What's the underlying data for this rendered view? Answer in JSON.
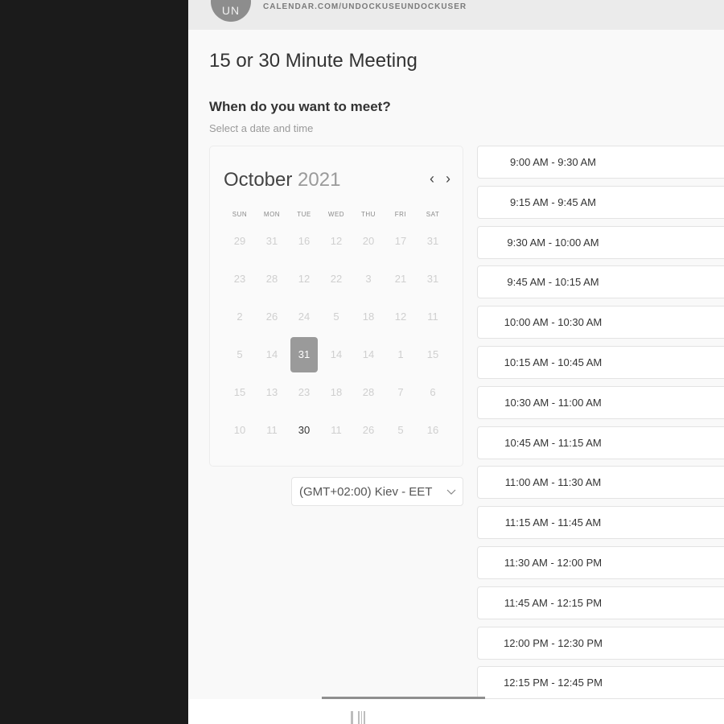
{
  "header": {
    "avatar_initials": "UN",
    "url": "CALENDAR.COM/UNDOCKUSEUNDOCKUSER"
  },
  "title": "15 or 30 Minute Meeting",
  "subtitle": "When do you want to meet?",
  "hint": "Select a date and time",
  "calendar": {
    "month": "October",
    "year": "2021",
    "prev_icon": "‹",
    "next_icon": "›",
    "weekdays": [
      "SUN",
      "MON",
      "TUE",
      "WED",
      "THU",
      "FRI",
      "SAT"
    ],
    "weeks": [
      [
        "29",
        "31",
        "16",
        "12",
        "20",
        "17",
        "31"
      ],
      [
        "23",
        "28",
        "12",
        "22",
        "3",
        "21",
        "31"
      ],
      [
        "2",
        "26",
        "24",
        "5",
        "18",
        "12",
        "11"
      ],
      [
        "5",
        "14",
        "31",
        "14",
        "14",
        "1",
        "15"
      ],
      [
        "15",
        "13",
        "23",
        "18",
        "28",
        "7",
        "6"
      ],
      [
        "10",
        "11",
        "30",
        "11",
        "26",
        "5",
        "16"
      ]
    ],
    "selected_cell": [
      3,
      2
    ],
    "available_cells": [
      [
        5,
        2
      ]
    ]
  },
  "timezone": {
    "label": "(GMT+02:00) Kiev - EET"
  },
  "time_slots": [
    "9:00 AM - 9:30 AM",
    "9:15 AM - 9:45 AM",
    "9:30 AM - 10:00 AM",
    "9:45 AM - 10:15 AM",
    "10:00 AM - 10:30 AM",
    "10:15 AM - 10:45 AM",
    "10:30 AM - 11:00 AM",
    "10:45 AM - 11:15 AM",
    "11:00 AM - 11:30 AM",
    "11:15 AM - 11:45 AM",
    "11:30 AM - 12:00 PM",
    "11:45 AM - 12:15 PM",
    "12:00 PM - 12:30 PM",
    "12:15 PM - 12:45 PM"
  ],
  "colors": {
    "selected_day": "#9a9a9a",
    "app_background": "#f9f9f9",
    "side_background": "#1b1b1b"
  }
}
